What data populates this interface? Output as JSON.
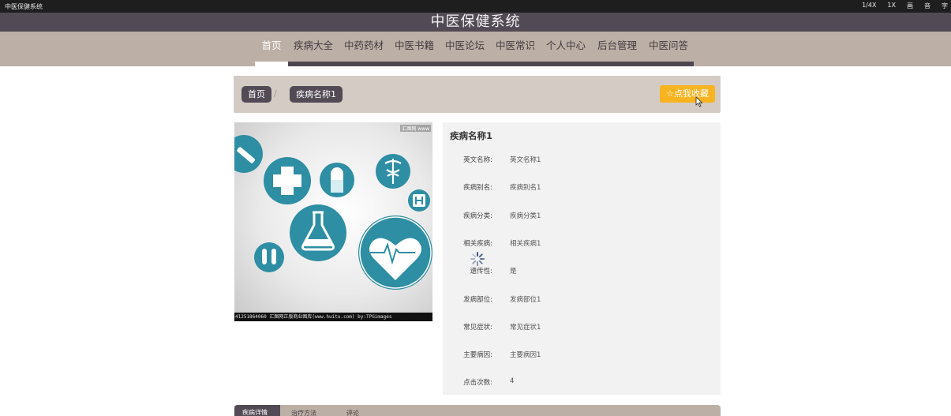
{
  "window": {
    "title": "中医保健系统",
    "controls": [
      "1/4X",
      "1X",
      "画",
      "音",
      "字"
    ]
  },
  "site": {
    "title": "中医保健系统"
  },
  "nav": {
    "items": [
      "首页",
      "疾病大全",
      "中药药材",
      "中医书籍",
      "中医论坛",
      "中医常识",
      "个人中心",
      "后台管理",
      "中医问答"
    ],
    "active_index": 0
  },
  "breadcrumb": {
    "home": "首页",
    "separator": "/",
    "current": "疾病名称1"
  },
  "favorite_button": {
    "icon": "star-outline-icon",
    "label": "点我收藏"
  },
  "image": {
    "caption": "41251864060  汇图网正版商业图库(www.huitu.com) by:TPGimages",
    "watermark": "汇图网 www"
  },
  "detail": {
    "title": "疾病名称1",
    "fields": [
      {
        "label": "英文名称:",
        "value": "英文名称1"
      },
      {
        "label": "疾病别名:",
        "value": "疾病别名1"
      },
      {
        "label": "疾病分类:",
        "value": "疾病分类1"
      },
      {
        "label": "相关疾病:",
        "value": "相关疾病1"
      },
      {
        "label": "遗传性:",
        "value": "是"
      },
      {
        "label": "发病部位:",
        "value": "发病部位1"
      },
      {
        "label": "常见症状:",
        "value": "常见症状1"
      },
      {
        "label": "主要病因:",
        "value": "主要病因1"
      },
      {
        "label": "点击次数:",
        "value": "4"
      }
    ]
  },
  "tabs": {
    "items": [
      "疾病详情",
      "治疗方法",
      "评论"
    ]
  },
  "colors": {
    "header": "#524a55",
    "nav": "#bcafa5",
    "crumbbar": "#d4cbc4",
    "accent": "#f7b320",
    "medical_teal": "#2e8ea3"
  }
}
